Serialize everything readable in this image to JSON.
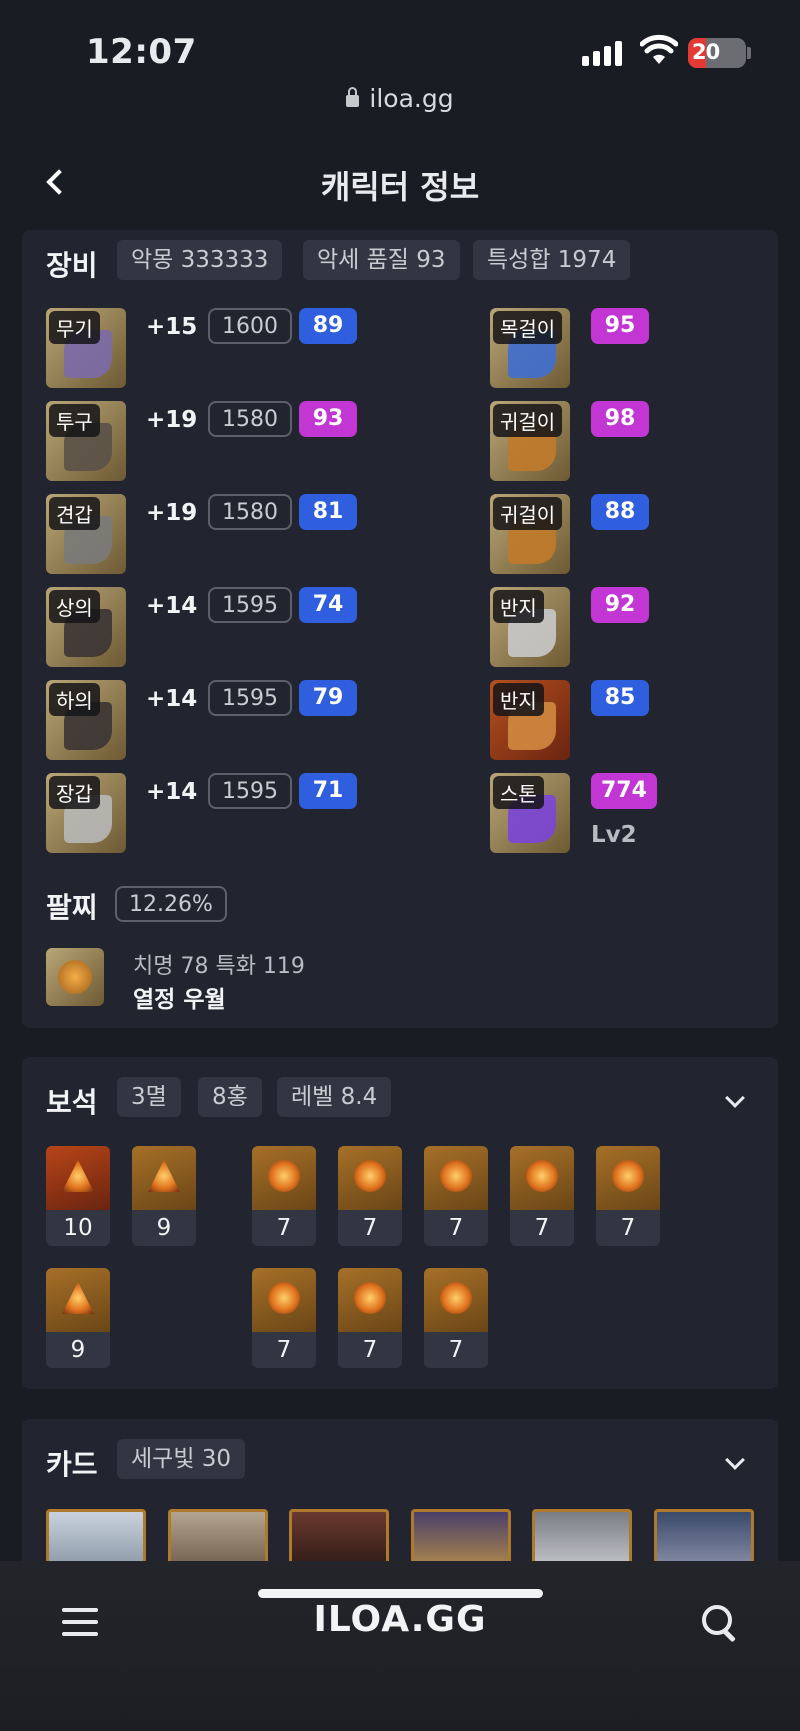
{
  "status": {
    "time": "12:07",
    "battery": "20"
  },
  "browser": {
    "url": "iloa.gg"
  },
  "nav": {
    "title": "캐릭터 정보"
  },
  "equipment": {
    "title": "장비",
    "chips": [
      "악몽 333333",
      "악세 품질 93",
      "특성합 1974"
    ],
    "armor": [
      {
        "slot": "무기",
        "enhance": "+15",
        "level": "1600",
        "quality": "89",
        "quality_color": "blue"
      },
      {
        "slot": "투구",
        "enhance": "+19",
        "level": "1580",
        "quality": "93",
        "quality_color": "pink"
      },
      {
        "slot": "견갑",
        "enhance": "+19",
        "level": "1580",
        "quality": "81",
        "quality_color": "blue"
      },
      {
        "slot": "상의",
        "enhance": "+14",
        "level": "1595",
        "quality": "74",
        "quality_color": "blue"
      },
      {
        "slot": "하의",
        "enhance": "+14",
        "level": "1595",
        "quality": "79",
        "quality_color": "blue"
      },
      {
        "slot": "장갑",
        "enhance": "+14",
        "level": "1595",
        "quality": "71",
        "quality_color": "blue"
      }
    ],
    "accessories": [
      {
        "slot": "목걸이",
        "quality": "95",
        "quality_color": "pink"
      },
      {
        "slot": "귀걸이",
        "quality": "98",
        "quality_color": "pink"
      },
      {
        "slot": "귀걸이",
        "quality": "88",
        "quality_color": "blue"
      },
      {
        "slot": "반지",
        "quality": "92",
        "quality_color": "pink"
      },
      {
        "slot": "반지",
        "quality": "85",
        "quality_color": "blue"
      },
      {
        "slot": "스톤",
        "quality": "774",
        "quality_color": "pink",
        "sub": "Lv2"
      }
    ],
    "bracelet": {
      "title": "팔찌",
      "percent": "12.26%",
      "stats": "치명 78   특화 119",
      "effects": "열정  우월"
    }
  },
  "gems": {
    "title": "보석",
    "chips": [
      "3멸",
      "8홍",
      "레벨 8.4"
    ],
    "row1": [
      {
        "level": "10",
        "kind": "red"
      },
      {
        "level": "9",
        "kind": "red-orange"
      },
      {
        "level": "7",
        "kind": "orange"
      },
      {
        "level": "7",
        "kind": "orange"
      },
      {
        "level": "7",
        "kind": "orange"
      },
      {
        "level": "7",
        "kind": "orange"
      },
      {
        "level": "7",
        "kind": "orange"
      }
    ],
    "row2": [
      {
        "level": "9",
        "kind": "red-orange"
      },
      {
        "level": "7",
        "kind": "orange"
      },
      {
        "level": "7",
        "kind": "orange"
      },
      {
        "level": "7",
        "kind": "orange"
      }
    ]
  },
  "cards": {
    "title": "카드",
    "chips": [
      "세구빛 30"
    ]
  },
  "bottom": {
    "brand": "ILOA.GG"
  },
  "colors": {
    "blue": "#2f5fdf",
    "pink": "#c236d4",
    "card_bg": "#222530",
    "page_bg": "#1a1c23"
  }
}
